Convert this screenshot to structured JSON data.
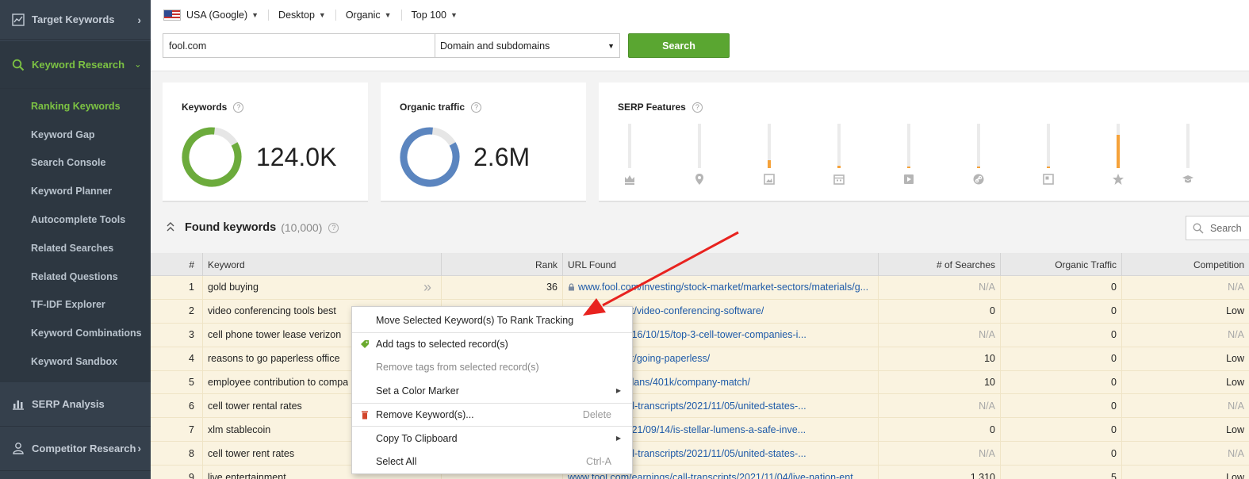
{
  "sidebar": {
    "sections": {
      "target_keywords": "Target Keywords",
      "keyword_research": "Keyword Research",
      "serp_analysis": "SERP Analysis",
      "competitor_research": "Competitor Research"
    },
    "items": [
      "Ranking Keywords",
      "Keyword Gap",
      "Search Console",
      "Keyword Planner",
      "Autocomplete Tools",
      "Related Searches",
      "Related Questions",
      "TF-IDF Explorer",
      "Keyword Combinations",
      "Keyword Sandbox"
    ]
  },
  "filters": {
    "country": "USA (Google)",
    "device": "Desktop",
    "type": "Organic",
    "top": "Top 100"
  },
  "search": {
    "domain_value": "fool.com",
    "scope": "Domain and subdomains",
    "button": "Search"
  },
  "cards": {
    "keywords": {
      "title": "Keywords",
      "value": "124.0K"
    },
    "organic": {
      "title": "Organic traffic",
      "value": "2.6M"
    },
    "serp": {
      "title": "SERP Features"
    }
  },
  "serp_features": [
    {
      "icon": "crown-icon",
      "fill": 0.0
    },
    {
      "icon": "map-pin-icon",
      "fill": 0.0
    },
    {
      "icon": "image-icon",
      "fill": 0.18
    },
    {
      "icon": "calendar-icon",
      "fill": 0.06
    },
    {
      "icon": "video-icon",
      "fill": 0.04
    },
    {
      "icon": "link-icon",
      "fill": 0.04
    },
    {
      "icon": "panel-icon",
      "fill": 0.03
    },
    {
      "icon": "star-icon",
      "fill": 0.75
    },
    {
      "icon": "graduation-cap-icon",
      "fill": 0.0
    }
  ],
  "found": {
    "title": "Found keywords",
    "count": "(10,000)",
    "search_placeholder": "Search"
  },
  "table": {
    "headers": [
      "#",
      "Keyword",
      "Rank",
      "URL Found",
      "# of Searches",
      "Organic Traffic",
      "Competition"
    ],
    "rows": [
      [
        "1",
        "gold buying",
        "36",
        "www.fool.com/investing/stock-market/market-sectors/materials/g...",
        "N/A",
        "0",
        "N/A"
      ],
      [
        "2",
        "video conferencing tools best",
        "",
        "m/the-blueprint/video-conferencing-software/",
        "0",
        "0",
        "Low"
      ],
      [
        "3",
        "cell phone tower lease verizon",
        "",
        "m/investing/2016/10/15/top-3-cell-tower-companies-i...",
        "N/A",
        "0",
        "N/A"
      ],
      [
        "4",
        "reasons to go paperless office",
        "",
        "m/the-blueprint/going-paperless/",
        "10",
        "0",
        "Low"
      ],
      [
        "5",
        "employee contribution to compa",
        "",
        "m/retirement/plans/401k/company-match/",
        "10",
        "0",
        "Low"
      ],
      [
        "6",
        "cell tower rental rates",
        "",
        "m/earnings/call-transcripts/2021/11/05/united-states-...",
        "N/A",
        "0",
        "N/A"
      ],
      [
        "7",
        "xlm stablecoin",
        "",
        "m/investing/2021/09/14/is-stellar-lumens-a-safe-inve...",
        "0",
        "0",
        "Low"
      ],
      [
        "8",
        "cell tower rent rates",
        "",
        "m/earnings/call-transcripts/2021/11/05/united-states-...",
        "N/A",
        "0",
        "N/A"
      ],
      [
        "9",
        "live entertainment",
        "",
        "www.fool.com/earnings/call-transcripts/2021/11/04/live-nation-ent...",
        "1,310",
        "5",
        "Low"
      ]
    ]
  },
  "context_menu": {
    "move": "Move Selected Keyword(s) To Rank Tracking",
    "add_tags": "Add tags to selected record(s)",
    "remove_tags": "Remove tags from selected record(s)",
    "color_marker": "Set a Color Marker",
    "remove_kw": "Remove Keyword(s)...",
    "remove_kw_shortcut": "Delete",
    "copy": "Copy To Clipboard",
    "select_all": "Select All",
    "select_all_shortcut": "Ctrl-A"
  },
  "colors": {
    "accent_green": "#7cc243",
    "button_green": "#5aa631",
    "donut_keywords": "#6cab3c",
    "donut_traffic": "#5b85bf",
    "serp_fill": "#f5a23a",
    "row_highlight": "#faf3e0",
    "annotation_arrow": "#e8231f"
  }
}
